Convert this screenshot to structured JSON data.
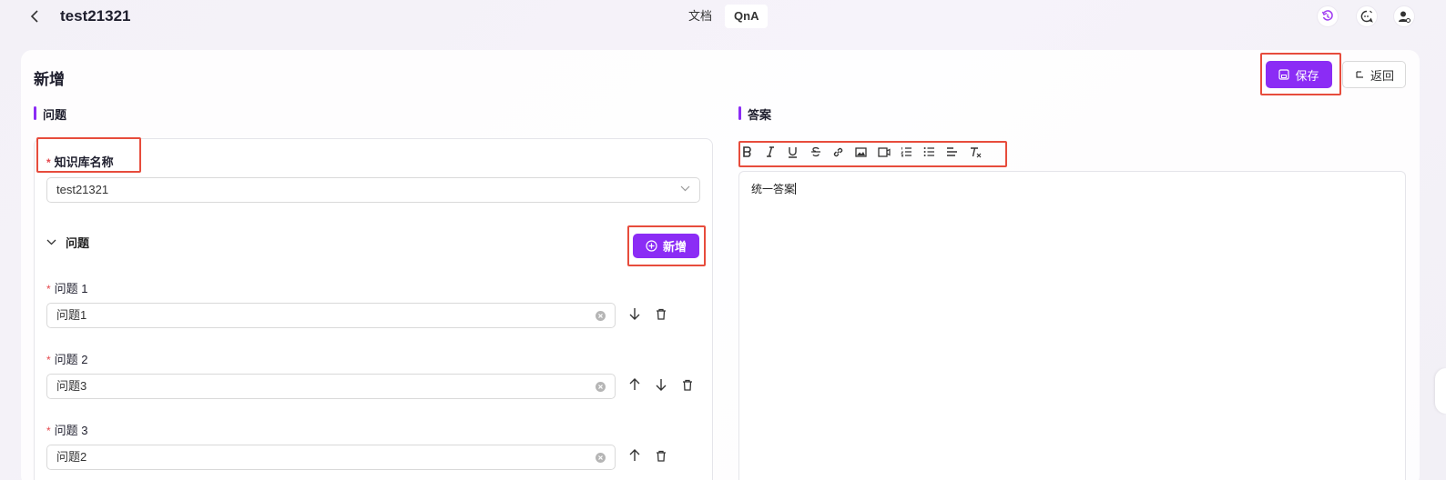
{
  "header": {
    "title": "test21321",
    "tabs": [
      {
        "label": "文档",
        "active": false
      },
      {
        "label": "QnA",
        "active": true
      }
    ]
  },
  "form": {
    "title": "新增",
    "save_label": "保存",
    "back_label": "返回",
    "question_section": "问题",
    "answer_section": "答案",
    "kb_label": "知识库名称",
    "kb_value": "test21321",
    "questions_group_label": "问题",
    "add_label": "新增",
    "questions": [
      {
        "label": "问题 1",
        "value": "问题1"
      },
      {
        "label": "问题 2",
        "value": "问题3"
      },
      {
        "label": "问题 3",
        "value": "问题2"
      }
    ],
    "answer_text": "统一答案"
  },
  "colors": {
    "accent": "#8b2cf5",
    "highlight": "#e74c3c",
    "required": "#e5484d"
  },
  "icons": [
    "chevron-left-icon",
    "history-icon",
    "chat-icon",
    "user-settings-icon",
    "save-icon",
    "return-icon",
    "chevron-down-icon",
    "plus-circle-icon",
    "arrow-up-icon",
    "arrow-down-icon",
    "trash-icon",
    "clear-icon",
    "bold-icon",
    "italic-icon",
    "underline-icon",
    "strikethrough-icon",
    "link-icon",
    "image-icon",
    "video-icon",
    "ordered-list-icon",
    "bullet-list-icon",
    "align-left-icon",
    "clear-format-icon"
  ]
}
